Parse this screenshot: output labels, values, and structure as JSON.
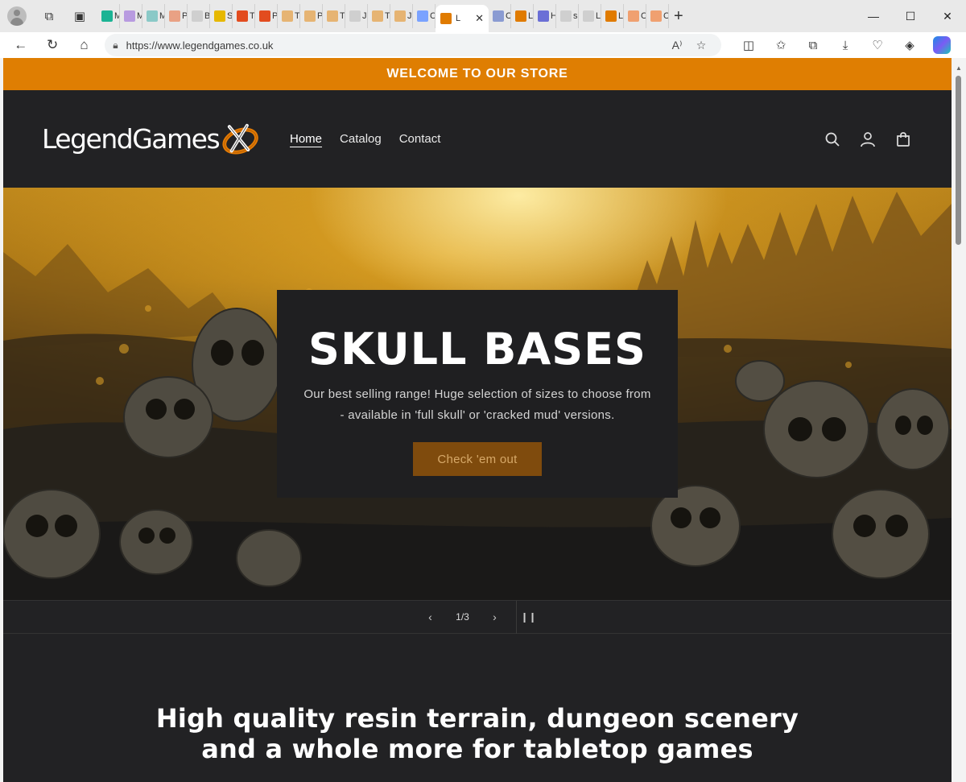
{
  "browser": {
    "tabs": [
      {
        "letter": "M",
        "color": "#1bb394"
      },
      {
        "letter": "M",
        "color": "#b89be0"
      },
      {
        "letter": "M",
        "color": "#8ac9c7"
      },
      {
        "letter": "P",
        "color": "#e9a184"
      },
      {
        "letter": "B",
        "color": "#cfcfcf"
      },
      {
        "letter": "S",
        "color": "#e6b800"
      },
      {
        "letter": "T",
        "color": "#e24c1f"
      },
      {
        "letter": "P",
        "color": "#e24c1f"
      },
      {
        "letter": "T",
        "color": "#e6b473"
      },
      {
        "letter": "P",
        "color": "#e6b473"
      },
      {
        "letter": "T",
        "color": "#e6b473"
      },
      {
        "letter": "J",
        "color": "#cfcfcf"
      },
      {
        "letter": "T",
        "color": "#e6b473"
      },
      {
        "letter": "J",
        "color": "#e6b473"
      },
      {
        "letter": "C",
        "color": "#7aa2ff"
      }
    ],
    "active_tab": {
      "letter": "L",
      "color": "#e07b00"
    },
    "tabs_after": [
      {
        "letter": "C",
        "color": "#8a9bd2"
      },
      {
        "letter": "L",
        "color": "#e07b00"
      },
      {
        "letter": "H",
        "color": "#6b6fd6"
      },
      {
        "letter": "s",
        "color": "#cfcfcf"
      },
      {
        "letter": "L",
        "color": "#cfcfcf"
      },
      {
        "letter": "L",
        "color": "#e07b00"
      },
      {
        "letter": "C",
        "color": "#f0a070"
      },
      {
        "letter": "C",
        "color": "#f0a070"
      }
    ],
    "url": "https://www.legendgames.co.uk"
  },
  "site": {
    "announcement": "WELCOME TO OUR STORE",
    "logo": {
      "legend": "Legend",
      "games": "Games"
    },
    "nav": [
      {
        "label": "Home",
        "current": true
      },
      {
        "label": "Catalog",
        "current": false
      },
      {
        "label": "Contact",
        "current": false
      }
    ],
    "hero": {
      "title": "SKULL BASES",
      "text": "Our best selling range! Huge selection of sizes to choose from - available in 'full skull' or 'cracked mud' versions.",
      "button": "Check 'em out"
    },
    "slider": {
      "counter": "1/3"
    },
    "tagline_line1": "High quality resin terrain, dungeon scenery",
    "tagline_line2": "and a whole more for tabletop games"
  },
  "colors": {
    "announcement_bg": "#df7e02",
    "page_bg": "#222224",
    "button_bg": "#7f4b0d"
  }
}
